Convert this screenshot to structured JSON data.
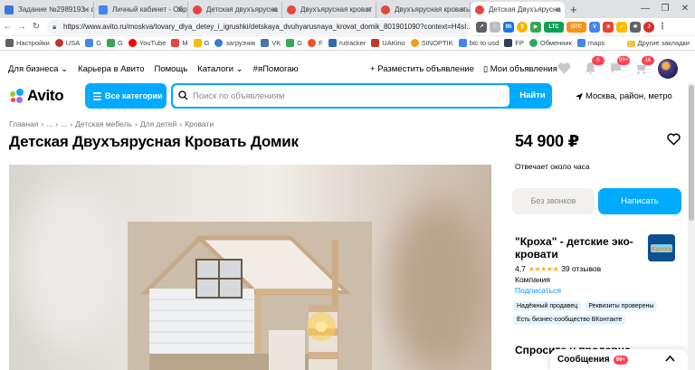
{
  "browser": {
    "tabs": [
      {
        "label": "Задание №2989193 - ф",
        "favicon_color": "#3b79d8",
        "active": false
      },
      {
        "label": "Личный кабинет - Обр",
        "favicon_color": "#4285f4",
        "active": false
      },
      {
        "label": "Детская двухъярусна",
        "favicon_color": "#e8453c",
        "active": false
      },
      {
        "label": "Двухъярусная кроват",
        "favicon_color": "#e8453c",
        "active": false
      },
      {
        "label": "Двухъярусная кровать",
        "favicon_color": "#e8453c",
        "active": false
      },
      {
        "label": "Детская Двухъярусна",
        "favicon_color": "#e8453c",
        "active": true
      }
    ],
    "new_tab": "+",
    "window_controls": [
      "—",
      "❐",
      "✕"
    ],
    "url": "https://www.avito.ru/moskva/tovary_dlya_detey_i_igrushki/detskaya_dvuhyarusnaya_krovat_domik_801901090?context=H4sI...",
    "extension_labels": [
      "96",
      "LTC 44.8",
      "BTC 92k"
    ],
    "bookmarks": [
      {
        "label": "Настройки",
        "color": "#5f6368"
      },
      {
        "label": "USA",
        "color": "#c0392b"
      },
      {
        "label": "G",
        "color": "#4285f4"
      },
      {
        "label": "G",
        "color": "#34a853"
      },
      {
        "label": "YouTube",
        "color": "#ff0000"
      },
      {
        "label": "M",
        "color": "#ea4335"
      },
      {
        "label": "G",
        "color": "#fbbc05"
      },
      {
        "label": "загрузчик",
        "color": "#3b79d8"
      },
      {
        "label": "VK",
        "color": "#4a76a8"
      },
      {
        "label": "G",
        "color": "#34a853"
      },
      {
        "label": "F",
        "color": "#f4511e"
      },
      {
        "label": "rutracker",
        "color": "#2b6cb0"
      },
      {
        "label": "UAKino",
        "color": "#c0392b"
      },
      {
        "label": "SINOPTIK",
        "color": "#f39c12"
      },
      {
        "label": "btc to usd",
        "color": "#4285f4"
      },
      {
        "label": "FP",
        "color": "#2c3e50"
      },
      {
        "label": "Обменник",
        "color": "#27ae60"
      },
      {
        "label": "maps",
        "color": "#4285f4"
      }
    ],
    "other_bookmarks": "Другие закладки"
  },
  "header": {
    "menu_left": [
      "Для бизнеса",
      "Карьера в Авито",
      "Помощь",
      "Каталоги",
      "#яПомогаю"
    ],
    "post_ad": "Разместить объявление",
    "my_ads": "Мои объявления",
    "badges": {
      "notifications": "6",
      "messages": "99+",
      "cart": "16"
    },
    "logo": "Avito",
    "categories_button": "Все категории",
    "search_placeholder": "Поиск по объявлениям",
    "search_button": "Найти",
    "region": "Москва, район, метро"
  },
  "listing": {
    "breadcrumb": [
      "Главная",
      "...",
      "...",
      "Детская мебель",
      "Для детей",
      "Кровати"
    ],
    "title": "Детская Двухъярусная Кровать Домик",
    "price": "54 900 ₽",
    "reply_time": "Отвечает около часа",
    "no_calls_button": "Без звонков",
    "write_button": "Написать"
  },
  "seller": {
    "name": "\"Кроха\" - детские эко-кровати",
    "rating": "4,7",
    "stars": "★★★★★",
    "reviews": "39 отзывов",
    "type": "Компания",
    "subscribe": "Подписаться",
    "logo_text": "Кроха",
    "badges": [
      "Надёжный продавец",
      "Реквизиты проверены",
      "Есть бизнес-сообщество ВКонтакте"
    ]
  },
  "ask_seller": "Спросите у продавца",
  "messages_widget": {
    "label": "Сообщения",
    "badge": "99+"
  },
  "colors": {
    "accent": "#00aaff",
    "badge_red": "#ff4053",
    "link": "#0099f7",
    "star": "#ffb021"
  }
}
